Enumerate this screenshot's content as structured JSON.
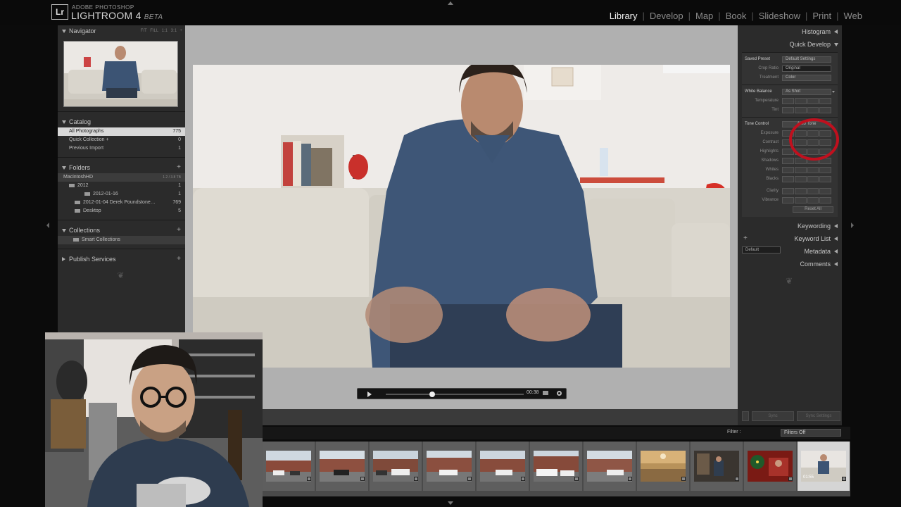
{
  "app": {
    "brand_small": "ADOBE PHOTOSHOP",
    "brand_name": "LIGHTROOM 4",
    "brand_beta": "BETA",
    "logo": "Lr"
  },
  "modules": [
    "Library",
    "Develop",
    "Map",
    "Book",
    "Slideshow",
    "Print",
    "Web"
  ],
  "active_module": "Library",
  "left_panel": {
    "navigator": {
      "title": "Navigator",
      "options": "FIT  FILL  1:1  3:1 ÷"
    },
    "catalog": {
      "title": "Catalog",
      "items": [
        {
          "label": "All Photographs",
          "count": "775"
        },
        {
          "label": "Quick Collection +",
          "count": "0"
        },
        {
          "label": "Previous Import",
          "count": "1"
        }
      ]
    },
    "folders": {
      "title": "Folders",
      "volume": {
        "label": "MacintoshHD",
        "info": "1.2 / 3.8 TB"
      },
      "items": [
        {
          "label": "2012",
          "count": "1"
        },
        {
          "label": "2012-01-16",
          "count": "1"
        },
        {
          "label": "2012-01-04 Derek Poundstone…",
          "count": "769"
        },
        {
          "label": "Desktop",
          "count": "5"
        }
      ]
    },
    "collections": {
      "title": "Collections",
      "items": [
        {
          "label": "Smart Collections"
        }
      ]
    },
    "publish": {
      "title": "Publish Services"
    }
  },
  "player": {
    "time": "00:38"
  },
  "right_panel": {
    "histogram": "Histogram",
    "quick_develop": "Quick Develop",
    "saved_preset": {
      "label": "Saved Preset",
      "value": "Default Settings"
    },
    "crop_ratio": {
      "label": "Crop Ratio",
      "value": "Original"
    },
    "treatment": {
      "label": "Treatment",
      "value": "Color"
    },
    "white_balance": {
      "label": "White Balance",
      "value": "As Shot"
    },
    "temperature": "Temperature",
    "tint": "Tint",
    "tone_control": {
      "label": "Tone Control",
      "button": "Auto Tone"
    },
    "exposure": "Exposure",
    "contrast": "Contrast",
    "highlights": "Highlights",
    "shadows": "Shadows",
    "whites": "Whites",
    "blacks": "Blacks",
    "clarity": "Clarity",
    "vibrance": "Vibrance",
    "reset_all": "Reset All",
    "keywording": "Keywording",
    "keyword_list": "Keyword List",
    "metadata": {
      "label": "Metadata",
      "preset": "Default"
    },
    "comments": "Comments",
    "sync": "Sync",
    "sync_settings": "Sync Settings"
  },
  "filmstrip": {
    "filter_label": "Filter :",
    "filter_value": "Filters Off",
    "selected_duration": "01:55"
  },
  "colors": {
    "accent_red": "#c0101e",
    "panel_bg": "#2b2b2b",
    "center_bg": "#b0b0b0"
  }
}
